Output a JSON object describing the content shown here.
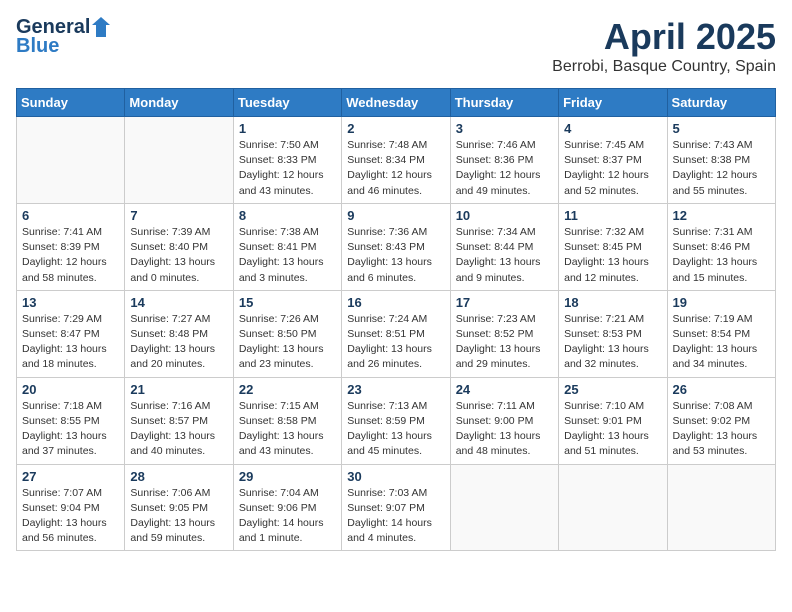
{
  "logo": {
    "general": "General",
    "blue": "Blue"
  },
  "header": {
    "month": "April 2025",
    "location": "Berrobi, Basque Country, Spain"
  },
  "weekdays": [
    "Sunday",
    "Monday",
    "Tuesday",
    "Wednesday",
    "Thursday",
    "Friday",
    "Saturday"
  ],
  "weeks": [
    [
      {
        "day": "",
        "info": ""
      },
      {
        "day": "",
        "info": ""
      },
      {
        "day": "1",
        "info": "Sunrise: 7:50 AM\nSunset: 8:33 PM\nDaylight: 12 hours\nand 43 minutes."
      },
      {
        "day": "2",
        "info": "Sunrise: 7:48 AM\nSunset: 8:34 PM\nDaylight: 12 hours\nand 46 minutes."
      },
      {
        "day": "3",
        "info": "Sunrise: 7:46 AM\nSunset: 8:36 PM\nDaylight: 12 hours\nand 49 minutes."
      },
      {
        "day": "4",
        "info": "Sunrise: 7:45 AM\nSunset: 8:37 PM\nDaylight: 12 hours\nand 52 minutes."
      },
      {
        "day": "5",
        "info": "Sunrise: 7:43 AM\nSunset: 8:38 PM\nDaylight: 12 hours\nand 55 minutes."
      }
    ],
    [
      {
        "day": "6",
        "info": "Sunrise: 7:41 AM\nSunset: 8:39 PM\nDaylight: 12 hours\nand 58 minutes."
      },
      {
        "day": "7",
        "info": "Sunrise: 7:39 AM\nSunset: 8:40 PM\nDaylight: 13 hours\nand 0 minutes."
      },
      {
        "day": "8",
        "info": "Sunrise: 7:38 AM\nSunset: 8:41 PM\nDaylight: 13 hours\nand 3 minutes."
      },
      {
        "day": "9",
        "info": "Sunrise: 7:36 AM\nSunset: 8:43 PM\nDaylight: 13 hours\nand 6 minutes."
      },
      {
        "day": "10",
        "info": "Sunrise: 7:34 AM\nSunset: 8:44 PM\nDaylight: 13 hours\nand 9 minutes."
      },
      {
        "day": "11",
        "info": "Sunrise: 7:32 AM\nSunset: 8:45 PM\nDaylight: 13 hours\nand 12 minutes."
      },
      {
        "day": "12",
        "info": "Sunrise: 7:31 AM\nSunset: 8:46 PM\nDaylight: 13 hours\nand 15 minutes."
      }
    ],
    [
      {
        "day": "13",
        "info": "Sunrise: 7:29 AM\nSunset: 8:47 PM\nDaylight: 13 hours\nand 18 minutes."
      },
      {
        "day": "14",
        "info": "Sunrise: 7:27 AM\nSunset: 8:48 PM\nDaylight: 13 hours\nand 20 minutes."
      },
      {
        "day": "15",
        "info": "Sunrise: 7:26 AM\nSunset: 8:50 PM\nDaylight: 13 hours\nand 23 minutes."
      },
      {
        "day": "16",
        "info": "Sunrise: 7:24 AM\nSunset: 8:51 PM\nDaylight: 13 hours\nand 26 minutes."
      },
      {
        "day": "17",
        "info": "Sunrise: 7:23 AM\nSunset: 8:52 PM\nDaylight: 13 hours\nand 29 minutes."
      },
      {
        "day": "18",
        "info": "Sunrise: 7:21 AM\nSunset: 8:53 PM\nDaylight: 13 hours\nand 32 minutes."
      },
      {
        "day": "19",
        "info": "Sunrise: 7:19 AM\nSunset: 8:54 PM\nDaylight: 13 hours\nand 34 minutes."
      }
    ],
    [
      {
        "day": "20",
        "info": "Sunrise: 7:18 AM\nSunset: 8:55 PM\nDaylight: 13 hours\nand 37 minutes."
      },
      {
        "day": "21",
        "info": "Sunrise: 7:16 AM\nSunset: 8:57 PM\nDaylight: 13 hours\nand 40 minutes."
      },
      {
        "day": "22",
        "info": "Sunrise: 7:15 AM\nSunset: 8:58 PM\nDaylight: 13 hours\nand 43 minutes."
      },
      {
        "day": "23",
        "info": "Sunrise: 7:13 AM\nSunset: 8:59 PM\nDaylight: 13 hours\nand 45 minutes."
      },
      {
        "day": "24",
        "info": "Sunrise: 7:11 AM\nSunset: 9:00 PM\nDaylight: 13 hours\nand 48 minutes."
      },
      {
        "day": "25",
        "info": "Sunrise: 7:10 AM\nSunset: 9:01 PM\nDaylight: 13 hours\nand 51 minutes."
      },
      {
        "day": "26",
        "info": "Sunrise: 7:08 AM\nSunset: 9:02 PM\nDaylight: 13 hours\nand 53 minutes."
      }
    ],
    [
      {
        "day": "27",
        "info": "Sunrise: 7:07 AM\nSunset: 9:04 PM\nDaylight: 13 hours\nand 56 minutes."
      },
      {
        "day": "28",
        "info": "Sunrise: 7:06 AM\nSunset: 9:05 PM\nDaylight: 13 hours\nand 59 minutes."
      },
      {
        "day": "29",
        "info": "Sunrise: 7:04 AM\nSunset: 9:06 PM\nDaylight: 14 hours\nand 1 minute."
      },
      {
        "day": "30",
        "info": "Sunrise: 7:03 AM\nSunset: 9:07 PM\nDaylight: 14 hours\nand 4 minutes."
      },
      {
        "day": "",
        "info": ""
      },
      {
        "day": "",
        "info": ""
      },
      {
        "day": "",
        "info": ""
      }
    ]
  ]
}
